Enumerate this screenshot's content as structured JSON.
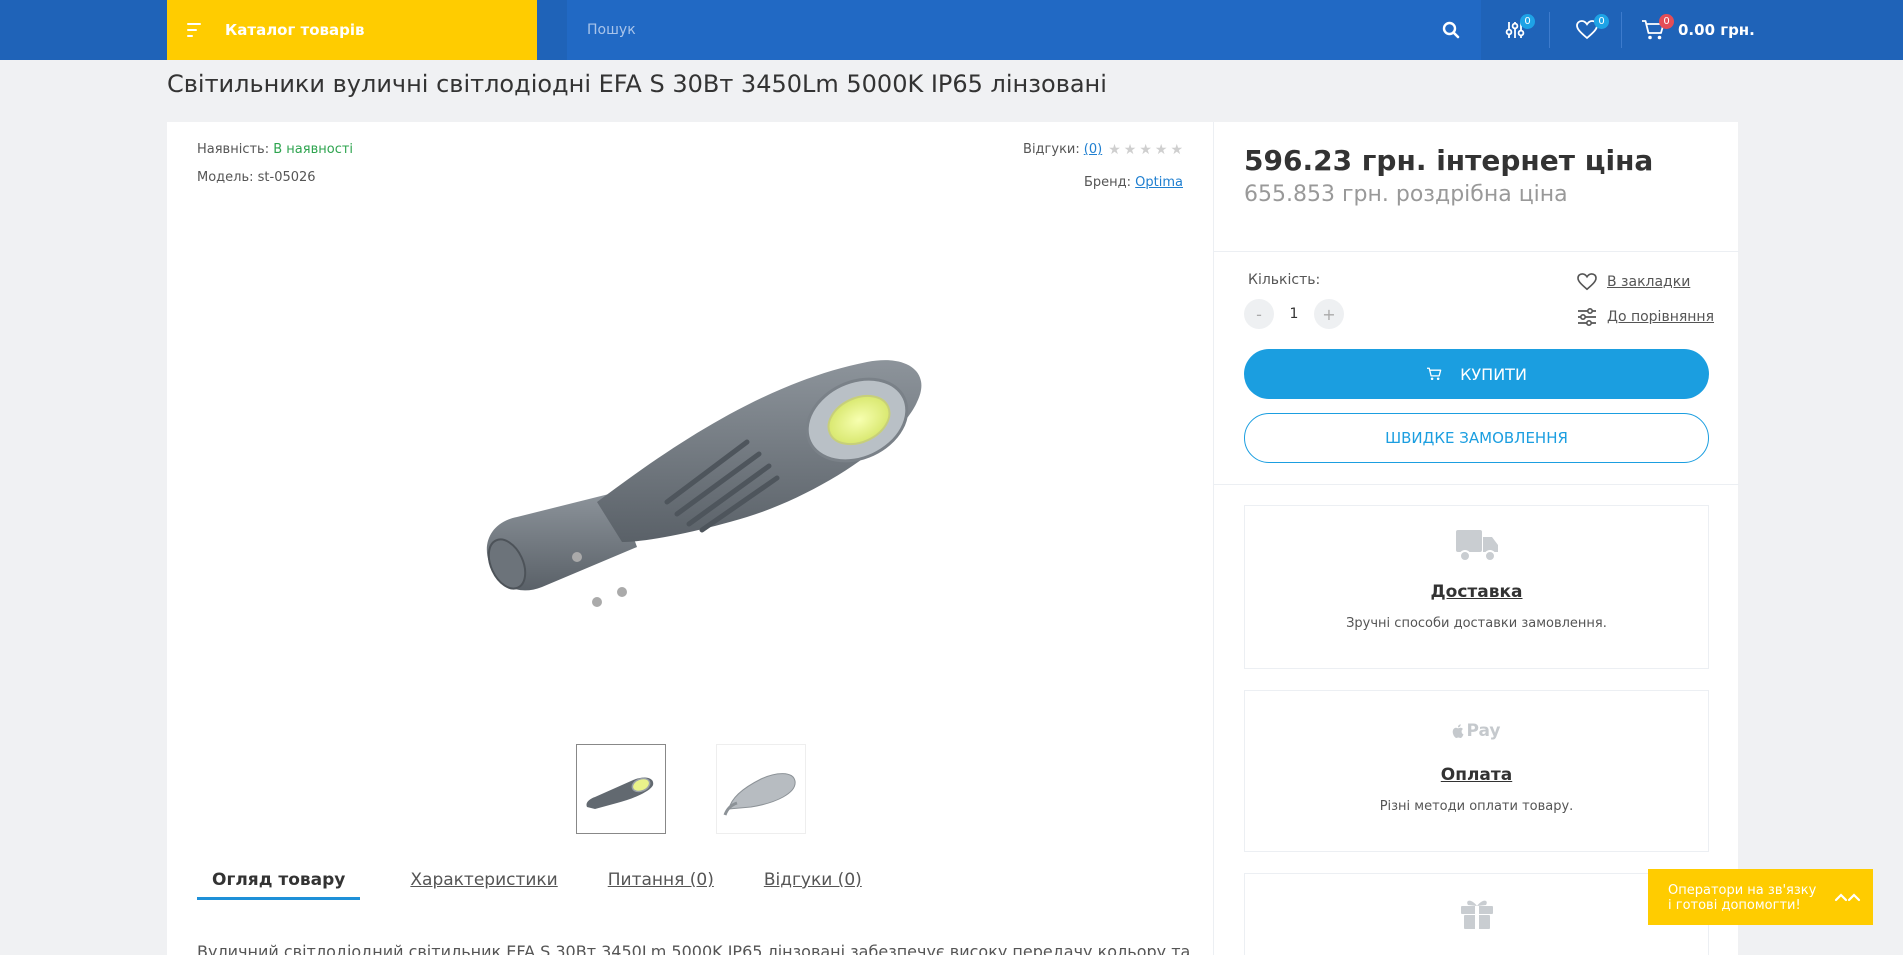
{
  "header": {
    "catalog_label": "Каталог товарів",
    "search_placeholder": "Пошук",
    "compare_count": "0",
    "wishlist_count": "0",
    "cart_count": "0",
    "cart_total": "0.00 грн.",
    "icons": [
      "menu-icon",
      "search-icon",
      "compare-icon",
      "heart-icon",
      "cart-icon"
    ]
  },
  "product": {
    "title": "Світильники вуличні світлодіодні EFA S 30Вт 3450Lm 5000K IP65 лінзовані",
    "availability_label": "Наявність:",
    "availability_value": "В наявності",
    "model_label": "Модель:",
    "model_value": "st-05026",
    "reviews_label": "Відгуки:",
    "reviews_count": "(0)",
    "rating": 0,
    "rating_max": 5,
    "brand_label": "Бренд:",
    "brand_value": "Optima",
    "thumbnails": 2,
    "active_thumbnail": 1
  },
  "tabs": [
    {
      "label": "Огляд товару",
      "active": true
    },
    {
      "label": "Характеристики",
      "active": false
    },
    {
      "label": "Питання (0)",
      "active": false
    },
    {
      "label": "Відгуки (0)",
      "active": false
    }
  ],
  "description_start": "Вуличний світлодіодний світильник EFA S 30Вт 3450Lm 5000K IP65 лінзовані забезпечує високу передачу кольору та",
  "side": {
    "price_internet": "596.23 грн. інтернет ціна",
    "price_retail": "655.853 грн. роздрібна ціна",
    "qty_label": "Кількість:",
    "qty_minus": "-",
    "qty_value": "1",
    "qty_plus": "+",
    "bookmark_label": "В закладки",
    "compare_label": "До порівняння",
    "buy_label": "КУПИТИ",
    "quick_order_label": "ШВИДКЕ ЗАМОВЛЕННЯ",
    "delivery_title": "Доставка",
    "delivery_text": "Зручні способи доставки замовлення.",
    "payment_title": "Оплата",
    "payment_text": "Різні методи оплати товару.",
    "payment_icon_text": "Pay"
  },
  "chat": {
    "line1": "Оператори на зв'язку",
    "line2": "і готові допомогти!"
  },
  "colors": {
    "header_blue": "#1f63b8",
    "catalog_yellow": "#ffcc00",
    "buy_blue": "#1b9ee0",
    "in_stock_green": "#2ea44f"
  }
}
